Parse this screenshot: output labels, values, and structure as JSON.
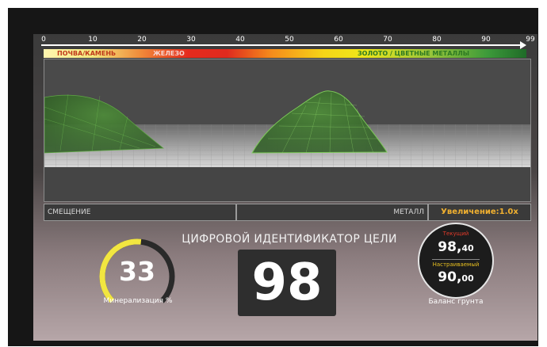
{
  "ruler": {
    "ticks": [
      "0",
      "10",
      "20",
      "30",
      "40",
      "50",
      "60",
      "70",
      "80",
      "90",
      "99"
    ]
  },
  "scale": {
    "soil": "ПОЧВА/КАМЕНЬ",
    "iron": "ЖЕЛЕЗО",
    "gold": "ЗОЛОТО / ЦВЕТНЫЕ МЕТАЛЛЫ"
  },
  "status": {
    "offset": "СМЕЩЕНИЕ",
    "metal": "МЕТАЛЛ",
    "zoom": "Увеличение:1.0x"
  },
  "dti": {
    "title": "ЦИФРОВОЙ ИДЕНТИФИКАТОР ЦЕЛИ",
    "value": "98"
  },
  "mineralization": {
    "value": "33",
    "label": "Минерализация %",
    "percent": 33
  },
  "ground_balance": {
    "current_label": "Текущий",
    "current_int": "98,",
    "current_dec": "40",
    "tracked_label": "Настраиваемый",
    "tracked_int": "90,",
    "tracked_dec": "00",
    "label": "Баланс грунта"
  },
  "colors": {
    "gauge": "#f2e640",
    "zoom": "#f0b030",
    "current_label": "#e03a2a",
    "tracked_label": "#e8c020"
  }
}
